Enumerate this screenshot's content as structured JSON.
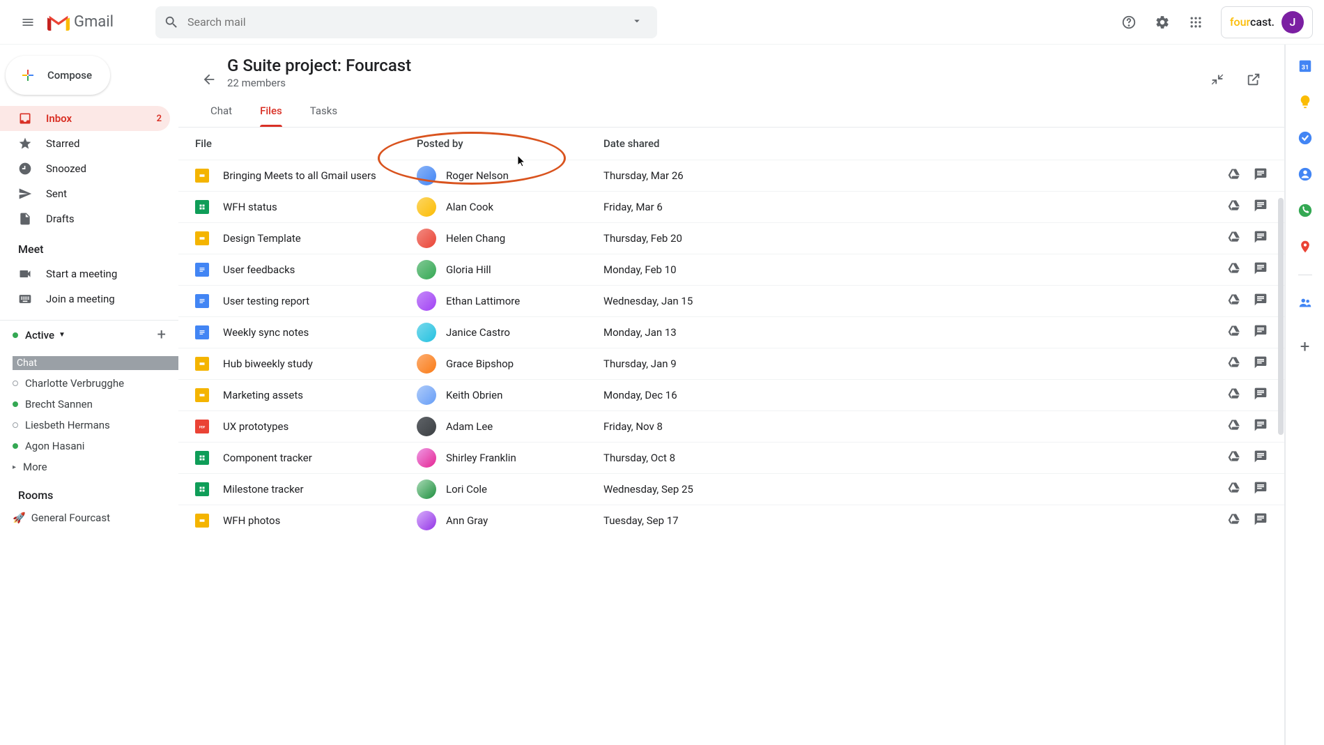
{
  "header": {
    "app_name": "Gmail",
    "search_placeholder": "Search mail",
    "fourcast_part1": "four",
    "fourcast_part2": "cast.",
    "avatar_initial": "J"
  },
  "compose_label": "Compose",
  "nav": [
    {
      "icon": "inbox",
      "label": "Inbox",
      "badge": "2",
      "active": true
    },
    {
      "icon": "star",
      "label": "Starred"
    },
    {
      "icon": "clock",
      "label": "Snoozed"
    },
    {
      "icon": "send",
      "label": "Sent"
    },
    {
      "icon": "file",
      "label": "Drafts"
    }
  ],
  "meet": {
    "header": "Meet",
    "start": "Start a meeting",
    "join": "Join a meeting"
  },
  "active_label": "Active",
  "chat_header": "Chat",
  "chat_contacts": [
    {
      "name": "Charlotte Verbrugghe",
      "online": false
    },
    {
      "name": "Brecht Sannen",
      "online": true
    },
    {
      "name": "Liesbeth Hermans",
      "online": false
    },
    {
      "name": "Agon Hasani",
      "online": true
    }
  ],
  "more_label": "More",
  "rooms_header": "Rooms",
  "room_item": "General Fourcast",
  "room": {
    "title": "G Suite project: Fourcast",
    "members": "22 members"
  },
  "tabs": {
    "chat": "Chat",
    "files": "Files",
    "tasks": "Tasks"
  },
  "table_headers": {
    "file": "File",
    "posted_by": "Posted by",
    "date_shared": "Date shared"
  },
  "files": [
    {
      "type": "slides",
      "name": "Bringing Meets to all Gmail users",
      "poster": "Roger Nelson",
      "date": "Thursday, Mar 26",
      "pa": "pa1"
    },
    {
      "type": "sheets",
      "name": "WFH status",
      "poster": "Alan Cook",
      "date": "Friday, Mar 6",
      "pa": "pa2"
    },
    {
      "type": "slides",
      "name": "Design Template",
      "poster": "Helen Chang",
      "date": "Thursday, Feb 20",
      "pa": "pa3"
    },
    {
      "type": "docs",
      "name": "User feedbacks",
      "poster": "Gloria Hill",
      "date": "Monday, Feb 10",
      "pa": "pa4"
    },
    {
      "type": "docs",
      "name": "User testing report",
      "poster": "Ethan Lattimore",
      "date": "Wednesday, Jan 15",
      "pa": "pa5"
    },
    {
      "type": "docs",
      "name": "Weekly sync notes",
      "poster": "Janice Castro",
      "date": "Monday, Jan 13",
      "pa": "pa6"
    },
    {
      "type": "slides",
      "name": "Hub biweekly study",
      "poster": "Grace Bipshop",
      "date": "Thursday, Jan 9",
      "pa": "pa7"
    },
    {
      "type": "slides",
      "name": "Marketing assets",
      "poster": "Keith Obrien",
      "date": "Monday, Dec 16",
      "pa": "pa8"
    },
    {
      "type": "pdf",
      "name": "UX prototypes",
      "poster": "Adam Lee",
      "date": "Friday, Nov 8",
      "pa": "pa9"
    },
    {
      "type": "sheets",
      "name": "Component tracker",
      "poster": "Shirley Franklin",
      "date": "Thursday, Oct 8",
      "pa": "pa10"
    },
    {
      "type": "sheets",
      "name": "Milestone tracker",
      "poster": "Lori Cole",
      "date": "Wednesday, Sep 25",
      "pa": "pa11"
    },
    {
      "type": "slides",
      "name": "WFH photos",
      "poster": "Ann Gray",
      "date": "Tuesday, Sep 17",
      "pa": "pa12"
    }
  ]
}
